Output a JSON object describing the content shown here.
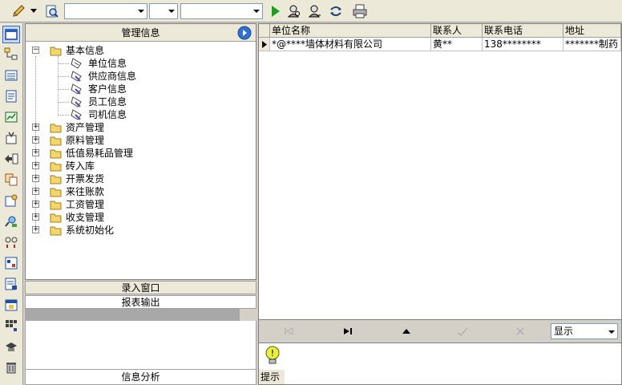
{
  "toolbar": {
    "combos": [
      "",
      "",
      ""
    ],
    "icons": [
      "pencil-icon",
      "dropdown-arrow-icon",
      "search-doc-icon",
      "play-icon",
      "find-user-icon",
      "find-user-alt-icon",
      "refresh-icon",
      "print-icon"
    ]
  },
  "sidebar_icons": [
    "window-icon",
    "org-chart-icon",
    "list-icon",
    "document-icon",
    "chart-icon",
    "inbox-icon",
    "export-icon",
    "copy-icon",
    "settings-icon",
    "user-search-icon",
    "chain-icon",
    "report-icon",
    "report-edit-icon",
    "calendar-icon",
    "grid-icon",
    "hat-icon",
    "trash-icon"
  ],
  "tree": {
    "title": "管理信息",
    "root_open": {
      "label": "基本信息",
      "children": [
        "单位信息",
        "供应商信息",
        "客户信息",
        "员工信息",
        "司机信息"
      ]
    },
    "collapsed": [
      "资产管理",
      "原料管理",
      "低值易耗品管理",
      "砖入库",
      "开票发货",
      "来往账款",
      "工资管理",
      "收支管理",
      "系统初始化"
    ]
  },
  "panels": {
    "entry_window": "录入窗口",
    "report_output": "报表输出",
    "info_analysis": "信息分析"
  },
  "grid": {
    "columns": [
      "单位名称",
      "联系人",
      "联系电话",
      "地址"
    ],
    "rows": [
      [
        "*@****墙体材料有限公司",
        "黄**",
        "138********",
        "*******制药"
      ]
    ]
  },
  "navigator": {
    "display_select": "显示"
  },
  "hint": {
    "label": "提示"
  },
  "colors": {
    "face": "#d4d0c8",
    "toolbar": "#ece9d8",
    "folder": "#f5d668",
    "play": "#18a018"
  }
}
